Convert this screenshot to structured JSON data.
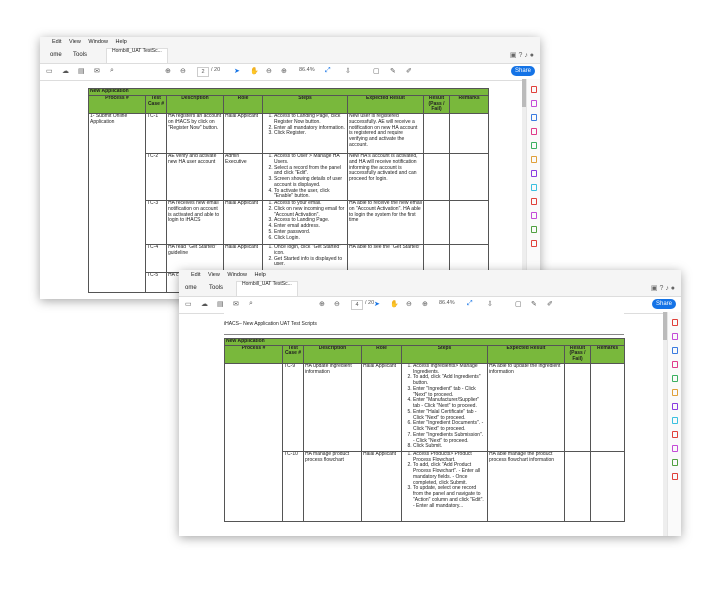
{
  "menu": [
    "Edit",
    "View",
    "Window",
    "Help"
  ],
  "win1": {
    "tabs": {
      "home": "ome",
      "tools": "Tools",
      "doc": "Hornbill_UAT TestSc..."
    },
    "page_current": "2",
    "page_total": "/ 20",
    "zoom": "86.4%",
    "share": "Share",
    "section": "New Application",
    "headers": [
      "Process #",
      "Test Case #",
      "Description",
      "Role",
      "Steps",
      "Expected Result",
      "Result (Pass / Fail)",
      "Remarks"
    ],
    "rows": [
      {
        "process": "1-   Submit Online Application",
        "case": "TC-1",
        "desc": "HA registers an account on iHACS by click on \"Register Now\" button.",
        "role": "Halal Applicant",
        "steps": [
          "Access to Landing Page, click Register Now button.",
          "Enter all mandatory information.",
          "Click Register."
        ],
        "expected": "New user is registered successfully. AE will receive a notification on new HA account is registered and require verifying and activate the account."
      },
      {
        "process": "",
        "case": "TC-2",
        "desc": "AE verify and activate new HA user account",
        "role": "Admin Executive",
        "steps": [
          "Access to User > Manage HA Users.",
          "Select a record from the panel and click \"Edit\".",
          "Screen showing details of user account is displayed.",
          "To activate the user, click \"Enable\" button."
        ],
        "expected": "New HA's account is activated, and HA will receive notification informing the account is successfully activated and can proceed for login."
      },
      {
        "process": "",
        "case": "TC-3",
        "desc": "HA receives new email notification on account is activated and able to login to iHACS",
        "role": "Halal Applicant",
        "steps": [
          "Access to your email.",
          "Click on new incoming email for \"Account Activation\".",
          "Access to Landing Page.",
          "Enter email address.",
          "Enter password.",
          "Click Login."
        ],
        "expected": "HA able to receive the new email on \"Account Activation\". HA able to login the system for the first time"
      },
      {
        "process": "",
        "case": "TC-4",
        "desc": "HA read \"Get Started\" guideline",
        "role": "Halal Applicant",
        "steps": [
          "Once login, click \"Get Started\" icon.",
          "Get Started info is displayed to user."
        ],
        "expected": "HA able to see the \"Get Started\""
      },
      {
        "process": "",
        "case": "TC-5",
        "desc": "HA c... profi...",
        "role": "",
        "steps": [],
        "expected": ""
      }
    ]
  },
  "win2": {
    "menu": [
      "Edit",
      "View",
      "Window",
      "Help"
    ],
    "tabs": {
      "home": "ome",
      "tools": "Tools",
      "doc": "Hornbill_UAT TestSc..."
    },
    "page_current": "4",
    "page_total": "/ 20",
    "zoom": "86.4%",
    "share": "Share",
    "doc_title": "iHACS– New Application UAT Test Scripts",
    "section": "New Application",
    "headers": [
      "Process #",
      "Test Case #",
      "Description",
      "Role",
      "Steps",
      "Expected Result",
      "Result (Pass / Fail)",
      "Remarks"
    ],
    "rows": [
      {
        "case": "TC-9",
        "desc": "HA update ingredient information",
        "role": "Halal Applicant",
        "steps": [
          "Access Ingredients> Manage Ingredients.",
          "To add, click \"Add Ingredients\" button.",
          "Enter \"Ingredient\" tab   -  Click \"Next\" to proceed.",
          "Enter \"Manufacturer/Supplier\" tab   -  Click \"Next\" to proceed.",
          "Enter \"Halal Certificate\" tab   -  Click \"Next\" to proceed.",
          "Enter \"Ingredient Documents\".   -  Click \"Next\" to proceed.",
          "Enter \"Ingredients Submission\".   -  Click \"Next\" to proceed.",
          "Click Submit."
        ],
        "expected": "HA able to update the ingredient information"
      },
      {
        "case": "TC-10",
        "desc": "HA manage product process flowchart",
        "role": "Halal Applicant",
        "steps": [
          "Access Products> Product Process Flowchart.",
          "To add, click \"Add Product Process Flowchart\".   -  Enter all mandatory fields.   -  Once completed, click Submit.",
          "To update, select one record from the panel and navigate to \"Action\" column and click \"Edit\".   -  Enter all mandatory..."
        ],
        "expected": "HA able manage the product process flowchart information"
      }
    ]
  },
  "sidebar_colors": [
    "#e0403a",
    "#c44ad8",
    "#3a7be0",
    "#e03a8a",
    "#3ab060",
    "#e0a03a",
    "#8a3ae0",
    "#3ac0e0",
    "#e0403a",
    "#c44ad8",
    "#50a040",
    "#e0403a"
  ]
}
